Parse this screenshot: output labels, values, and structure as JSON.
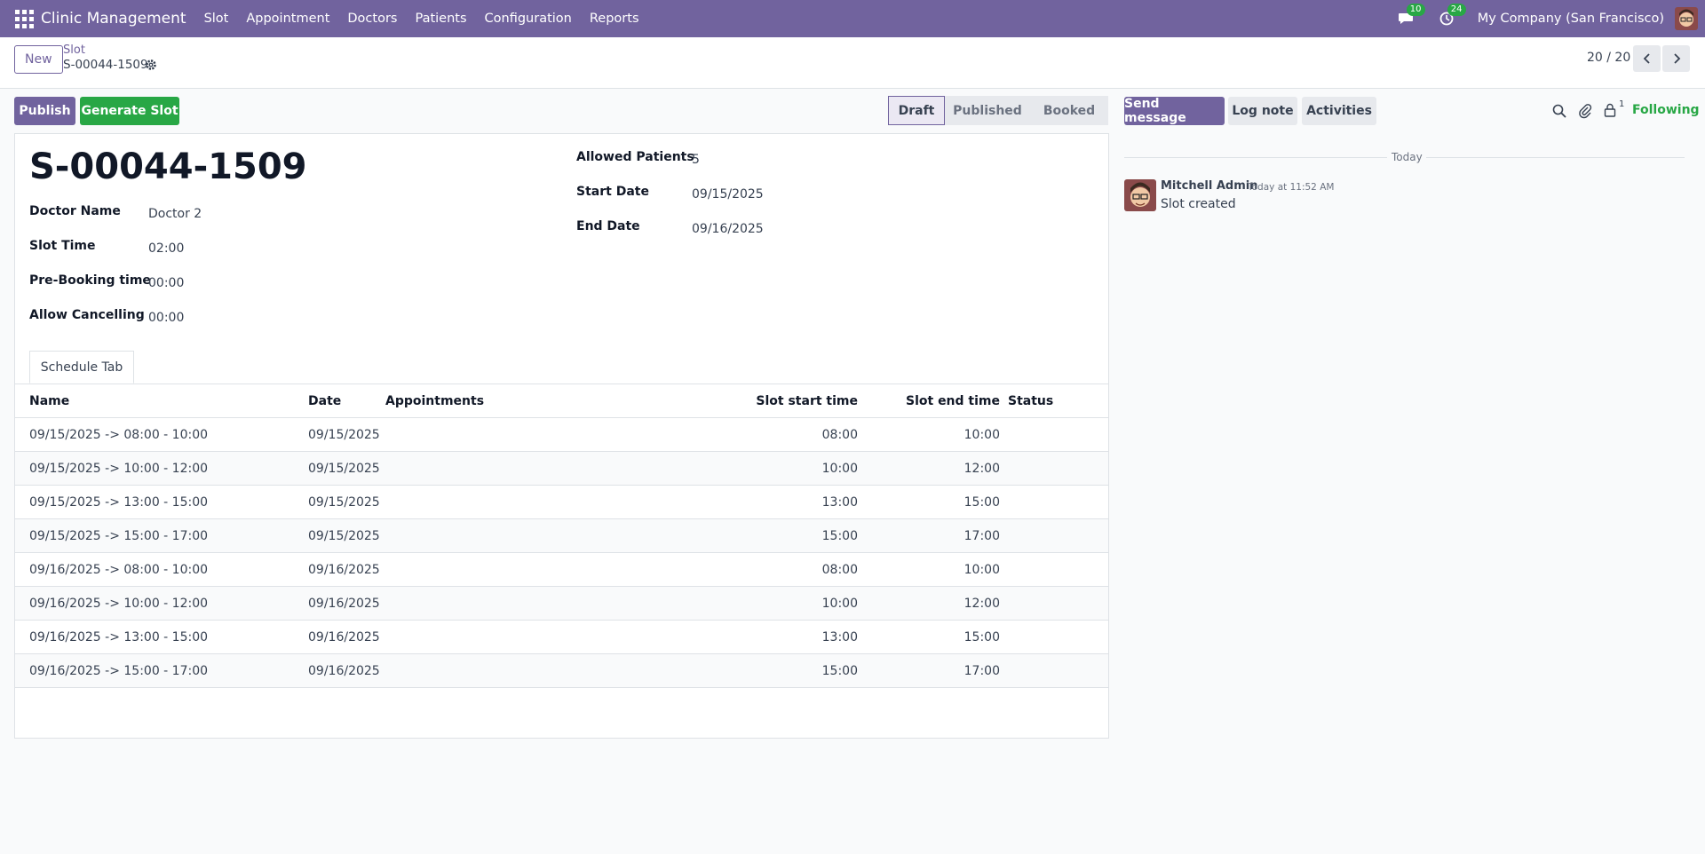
{
  "navbar": {
    "brand": "Clinic Management",
    "menu": [
      "Slot",
      "Appointment",
      "Doctors",
      "Patients",
      "Configuration",
      "Reports"
    ],
    "messages_count": "10",
    "activities_count": "24",
    "company": "My Company (San Francisco)"
  },
  "control": {
    "new_label": "New",
    "breadcrumb_parent": "Slot",
    "breadcrumb_current": "S-00044-1509",
    "pager": "20 / 20"
  },
  "actions": {
    "publish": "Publish",
    "generate_slot": "Generate Slot"
  },
  "statusbar": {
    "stages": [
      "Draft",
      "Published",
      "Booked"
    ],
    "active": "Draft"
  },
  "form": {
    "title": "S-00044-1509",
    "left_fields": [
      {
        "label": "Doctor Name",
        "value": "Doctor 2"
      },
      {
        "label": "Slot Time",
        "value": "02:00"
      },
      {
        "label": "Pre-Booking time",
        "value": "00:00"
      },
      {
        "label": "Allow Cancelling",
        "value": "00:00"
      }
    ],
    "right_fields": [
      {
        "label": "Allowed Patients",
        "value": "5"
      },
      {
        "label": "Start Date",
        "value": "09/15/2025"
      },
      {
        "label": "End Date",
        "value": "09/16/2025"
      }
    ],
    "tab": "Schedule Tab"
  },
  "schedule": {
    "columns": [
      "Name",
      "Date",
      "Appointments",
      "Slot start time",
      "Slot end time",
      "Status"
    ],
    "rows": [
      {
        "name": "09/15/2025 -> 08:00 - 10:00",
        "date": "09/15/2025",
        "appointments": "",
        "start": "08:00",
        "end": "10:00",
        "status": ""
      },
      {
        "name": "09/15/2025 -> 10:00 - 12:00",
        "date": "09/15/2025",
        "appointments": "",
        "start": "10:00",
        "end": "12:00",
        "status": ""
      },
      {
        "name": "09/15/2025 -> 13:00 - 15:00",
        "date": "09/15/2025",
        "appointments": "",
        "start": "13:00",
        "end": "15:00",
        "status": ""
      },
      {
        "name": "09/15/2025 -> 15:00 - 17:00",
        "date": "09/15/2025",
        "appointments": "",
        "start": "15:00",
        "end": "17:00",
        "status": ""
      },
      {
        "name": "09/16/2025 -> 08:00 - 10:00",
        "date": "09/16/2025",
        "appointments": "",
        "start": "08:00",
        "end": "10:00",
        "status": ""
      },
      {
        "name": "09/16/2025 -> 10:00 - 12:00",
        "date": "09/16/2025",
        "appointments": "",
        "start": "10:00",
        "end": "12:00",
        "status": ""
      },
      {
        "name": "09/16/2025 -> 13:00 - 15:00",
        "date": "09/16/2025",
        "appointments": "",
        "start": "13:00",
        "end": "15:00",
        "status": ""
      },
      {
        "name": "09/16/2025 -> 15:00 - 17:00",
        "date": "09/16/2025",
        "appointments": "",
        "start": "15:00",
        "end": "17:00",
        "status": ""
      }
    ]
  },
  "chatter": {
    "send_message": "Send message",
    "log_note": "Log note",
    "activities": "Activities",
    "followers_count": "1",
    "following": "Following",
    "date_separator": "Today",
    "message": {
      "author": "Mitchell Admin",
      "date": "Today at 11:52 AM",
      "body": "Slot created"
    }
  },
  "colors": {
    "brand": "#71639e",
    "success": "#28a745"
  }
}
